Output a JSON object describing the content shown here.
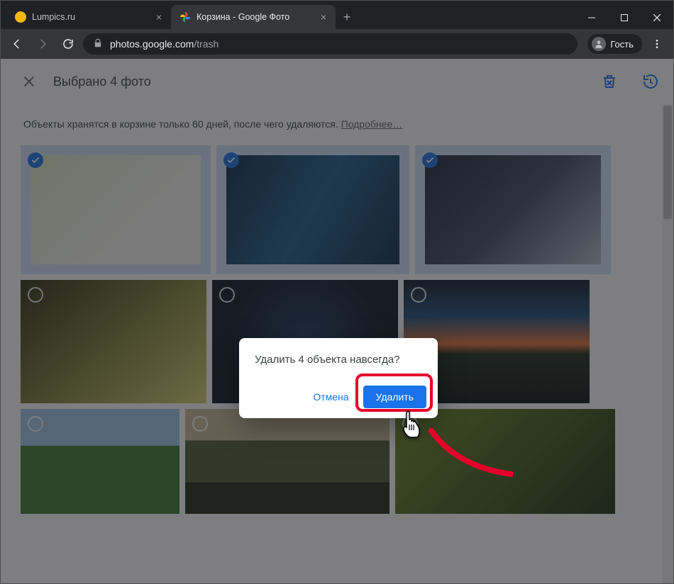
{
  "browser": {
    "tabs": [
      {
        "title": "Lumpics.ru",
        "active": false,
        "favicon": "lumpics"
      },
      {
        "title": "Корзина - Google Фото",
        "active": true,
        "favicon": "gphotos"
      }
    ],
    "url_domain": "photos.google.com",
    "url_path": "/trash",
    "profile_label": "Гость"
  },
  "appbar": {
    "title": "Выбрано 4 фото"
  },
  "info": {
    "text": "Объекты хранятся в корзине только 60 дней, после чего удаляются. ",
    "link": "Подробнее…"
  },
  "thumbs": [
    {
      "selected": true
    },
    {
      "selected": true
    },
    {
      "selected": true
    },
    {
      "selected": false
    },
    {
      "selected": false
    },
    {
      "selected": false
    },
    {
      "selected": false
    },
    {
      "selected": false
    },
    {
      "selected": false
    }
  ],
  "dialog": {
    "message": "Удалить 4 объекта навсегда?",
    "cancel": "Отмена",
    "confirm": "Удалить"
  }
}
